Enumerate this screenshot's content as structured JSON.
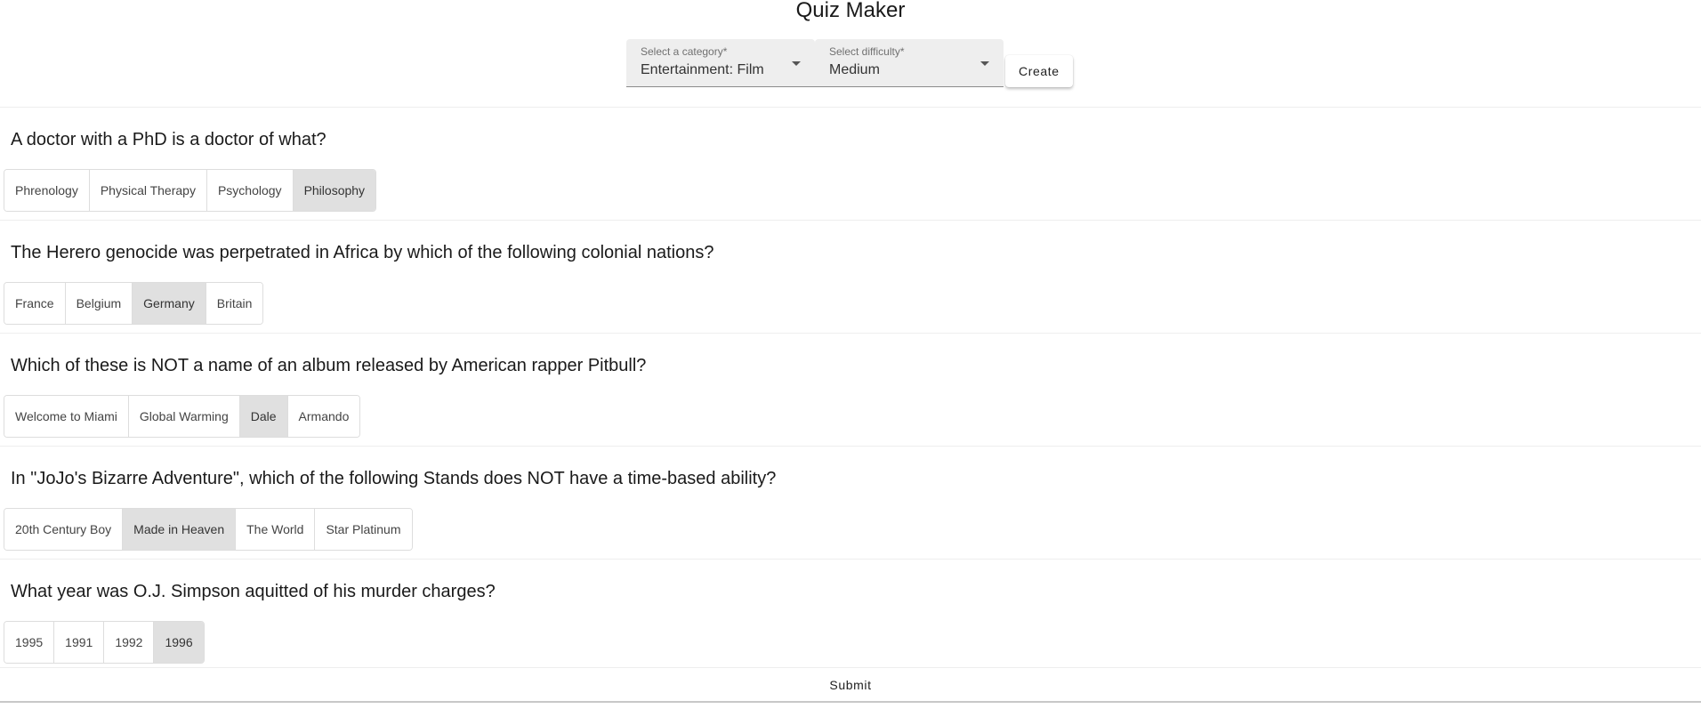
{
  "app": {
    "title": "Quiz Maker"
  },
  "toolbar": {
    "category": {
      "label": "Select a category*",
      "value": "Entertainment: Film"
    },
    "difficulty": {
      "label": "Select difficulty*",
      "value": "Medium"
    },
    "create_label": "Create"
  },
  "questions": [
    {
      "text": "A doctor with a PhD is a doctor of what?",
      "answers": [
        "Phrenology",
        "Physical Therapy",
        "Psychology",
        "Philosophy"
      ],
      "selected": "Philosophy"
    },
    {
      "text": "The Herero genocide was perpetrated in Africa by which of the following colonial nations?",
      "answers": [
        "France",
        "Belgium",
        "Germany",
        "Britain"
      ],
      "selected": "Germany"
    },
    {
      "text": "Which of these is NOT a name of an album released by American rapper Pitbull?",
      "answers": [
        "Welcome to Miami",
        "Global Warming",
        "Dale",
        "Armando"
      ],
      "selected": "Dale"
    },
    {
      "text": "In \"JoJo's Bizarre Adventure\", which of the following Stands does NOT have a time-based ability?",
      "answers": [
        "20th Century Boy",
        "Made in Heaven",
        "The World",
        "Star Platinum"
      ],
      "selected": "Made in Heaven"
    },
    {
      "text": "What year was O.J. Simpson aquitted of his murder charges?",
      "answers": [
        "1995",
        "1991",
        "1992",
        "1996"
      ],
      "selected": "1996"
    }
  ],
  "footer": {
    "submit_label": "Submit"
  },
  "colors": {
    "selected_answer_bg": "#e0e0e0",
    "select_field_bg": "#eeeeee"
  }
}
